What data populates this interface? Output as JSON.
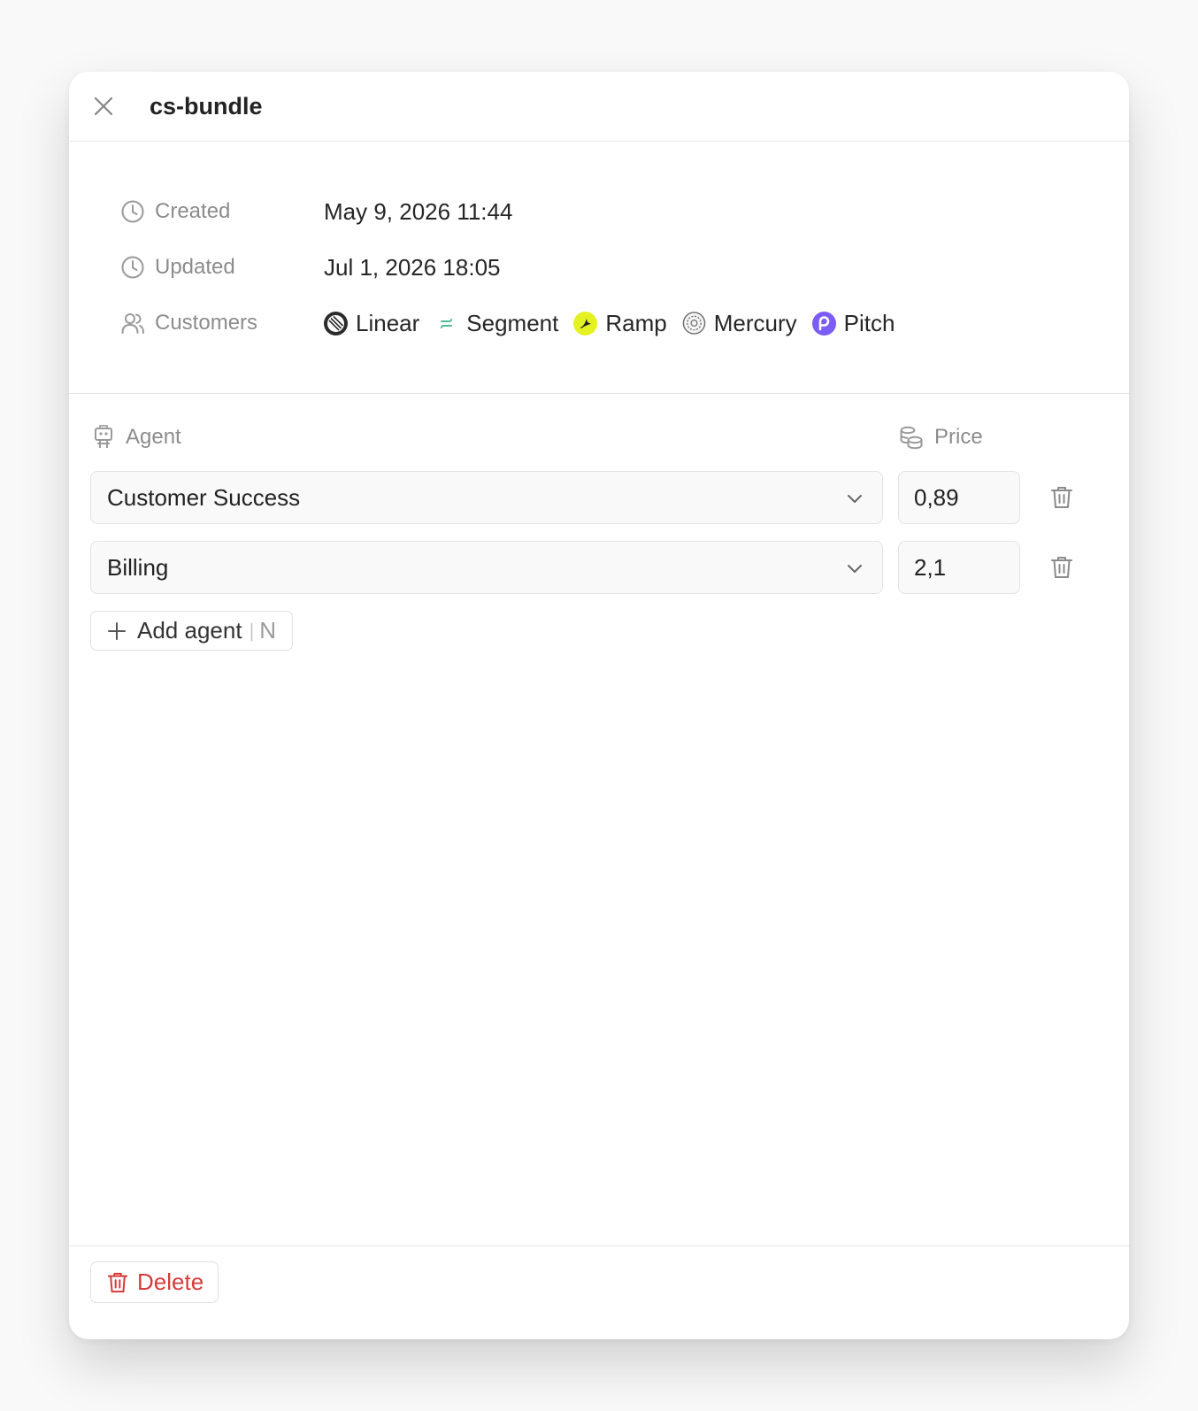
{
  "header": {
    "title": "cs-bundle"
  },
  "meta": {
    "created_label": "Created",
    "created_value": "May 9, 2026 11:44",
    "updated_label": "Updated",
    "updated_value": "Jul 1, 2026 18:05",
    "customers_label": "Customers",
    "customers": [
      {
        "name": "Linear",
        "icon": "linear-logo",
        "color": "#2b2b2b"
      },
      {
        "name": "Segment",
        "icon": "segment-logo",
        "color": "#52bd94"
      },
      {
        "name": "Ramp",
        "icon": "ramp-logo",
        "color": "#e4f222"
      },
      {
        "name": "Mercury",
        "icon": "mercury-logo",
        "color": "#6e6e6e"
      },
      {
        "name": "Pitch",
        "icon": "pitch-logo",
        "color": "#7b5cf5"
      }
    ]
  },
  "agents": {
    "agent_column_label": "Agent",
    "price_column_label": "Price",
    "rows": [
      {
        "agent": "Customer Success",
        "price": "0,89"
      },
      {
        "agent": "Billing",
        "price": "2,1"
      }
    ],
    "add_label": "Add agent",
    "add_shortcut": "N"
  },
  "footer": {
    "delete_label": "Delete"
  },
  "colors": {
    "danger": "#d93a3a",
    "muted": "#8c8c8c"
  }
}
